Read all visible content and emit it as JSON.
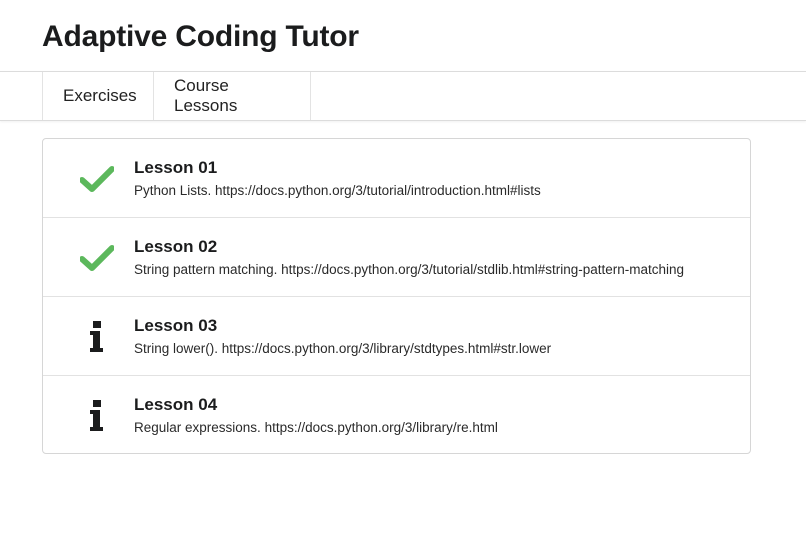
{
  "app": {
    "title": "Adaptive Coding Tutor"
  },
  "tabs": [
    {
      "label": "Exercises"
    },
    {
      "label": "Course Lessons"
    }
  ],
  "colors": {
    "check": "#5cb85c",
    "info": "#1b1c1d"
  },
  "lessons": [
    {
      "title": "Lesson 01",
      "description": "Python Lists. https://docs.python.org/3/tutorial/introduction.html#lists",
      "status_icon": "check-icon"
    },
    {
      "title": "Lesson 02",
      "description": "String pattern matching. https://docs.python.org/3/tutorial/stdlib.html#string-pattern-matching",
      "status_icon": "check-icon"
    },
    {
      "title": "Lesson 03",
      "description": "String lower(). https://docs.python.org/3/library/stdtypes.html#str.lower",
      "status_icon": "info-icon"
    },
    {
      "title": "Lesson 04",
      "description": "Regular expressions. https://docs.python.org/3/library/re.html",
      "status_icon": "info-icon"
    }
  ]
}
